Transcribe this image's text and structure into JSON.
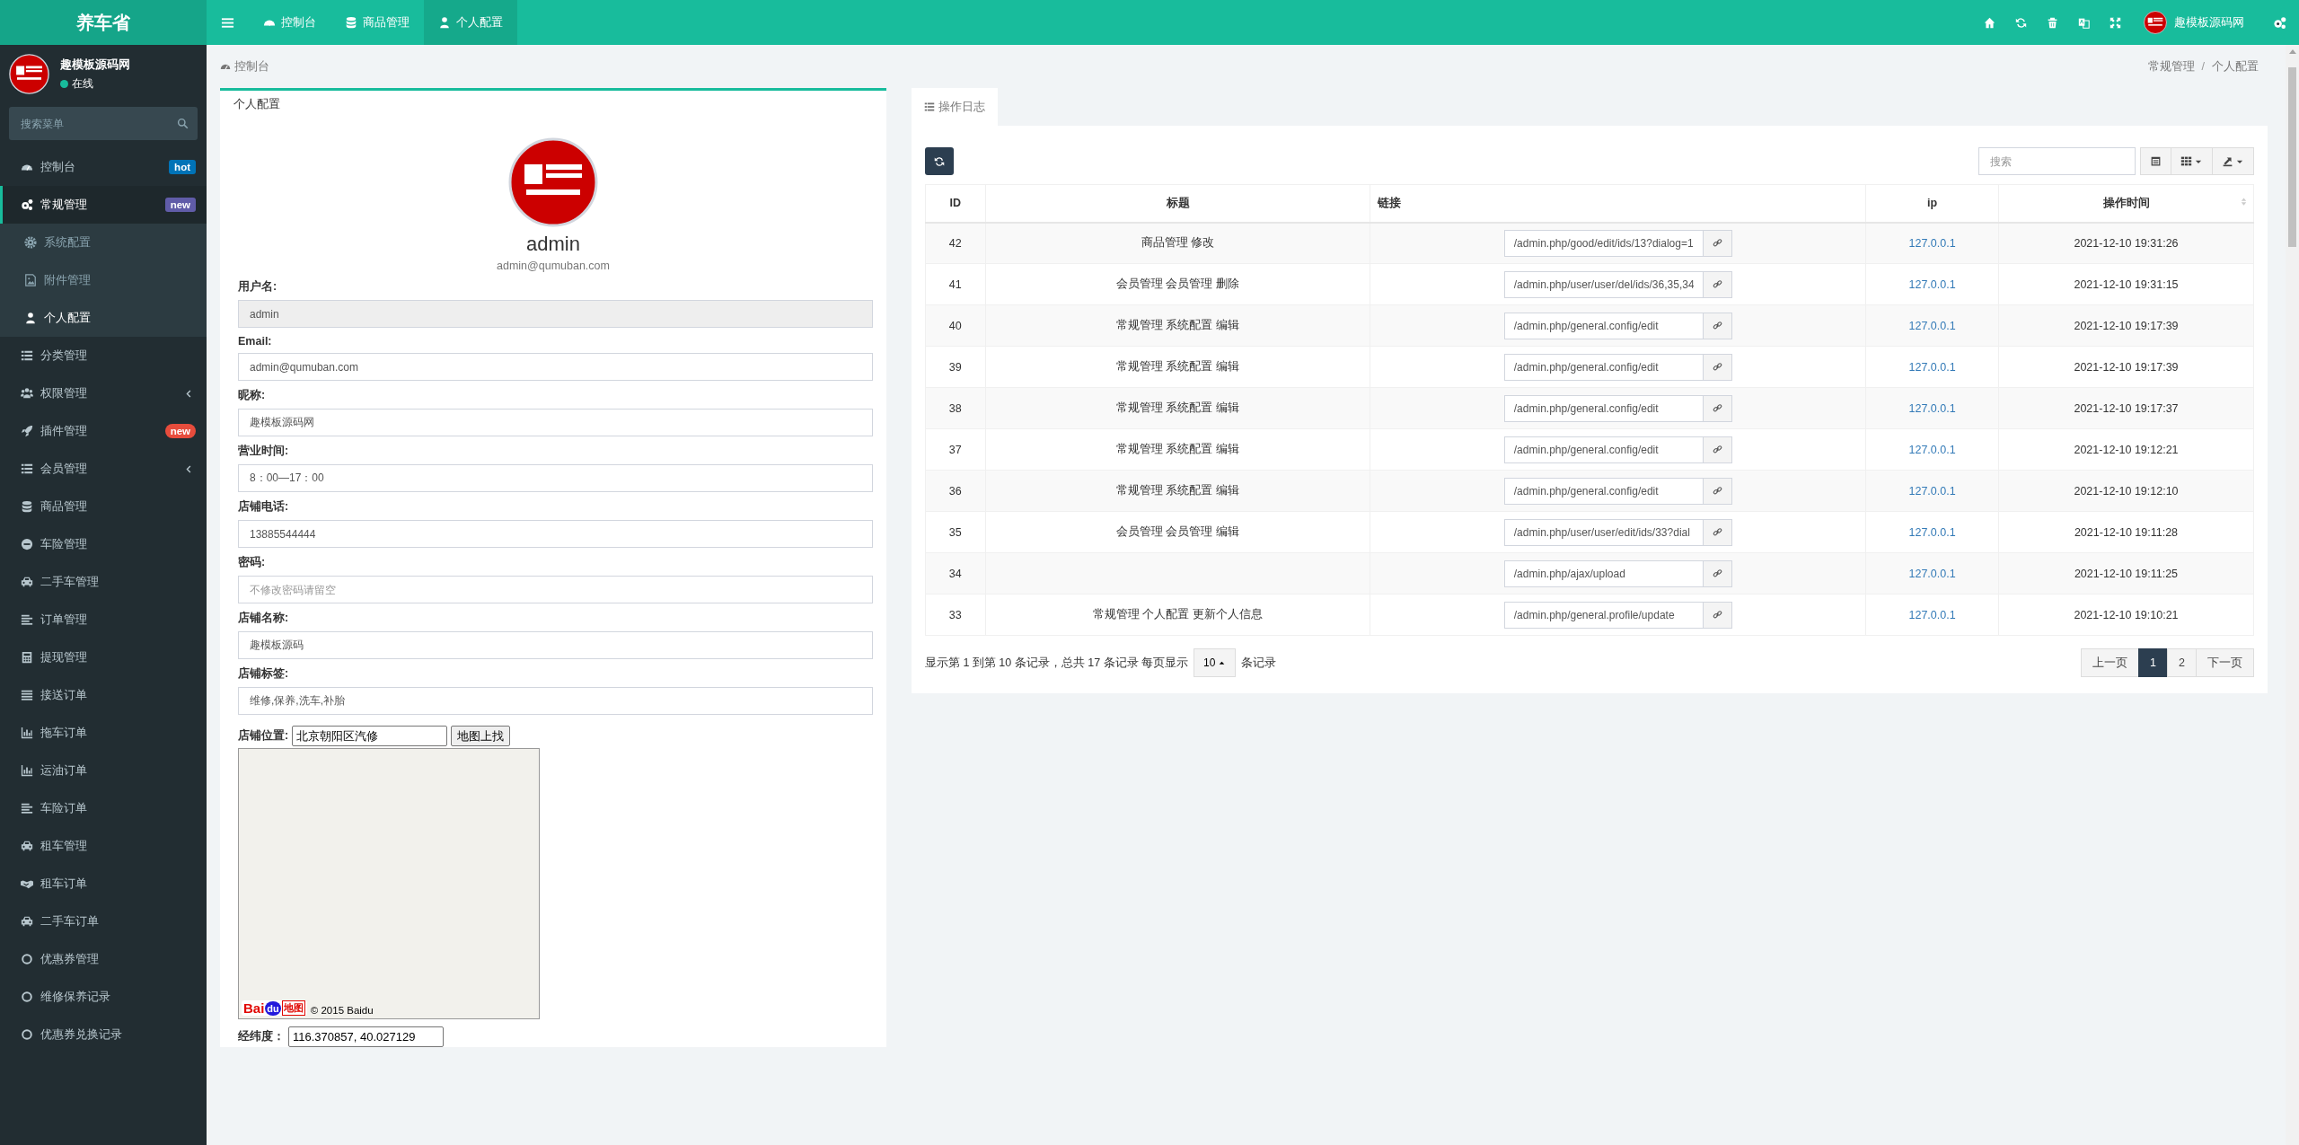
{
  "brand": "养车省",
  "topnav": [
    {
      "kind": "gauge",
      "label": "控制台",
      "selected": false
    },
    {
      "kind": "database",
      "label": "商品管理",
      "selected": false
    },
    {
      "kind": "user",
      "label": "个人配置",
      "selected": true
    }
  ],
  "topbar": {
    "user": "趣模板源码网"
  },
  "sidebar": {
    "user": {
      "name": "趣模板源码网",
      "status": "在线"
    },
    "search": {
      "placeholder": "搜索菜单"
    },
    "items": [
      {
        "kind": "gauge",
        "label": "控制台",
        "selected": false,
        "badge": {
          "text": "hot",
          "color": "#0073b7"
        }
      },
      {
        "kind": "gears",
        "label": "常规管理",
        "selected": true,
        "badge": {
          "text": "new",
          "color": "#605ca8"
        },
        "children": [
          {
            "kind": "gear",
            "label": "系统配置",
            "selected": false
          },
          {
            "kind": "image",
            "label": "附件管理",
            "selected": false
          },
          {
            "kind": "user",
            "label": "个人配置",
            "selected": true
          }
        ]
      },
      {
        "kind": "list",
        "label": "分类管理",
        "selected": false
      },
      {
        "kind": "users",
        "label": "权限管理",
        "selected": false,
        "submenu": true
      },
      {
        "kind": "rocket",
        "label": "插件管理",
        "selected": false,
        "badge": {
          "text": "new",
          "color": "#e74c3c"
        }
      },
      {
        "kind": "list",
        "label": "会员管理",
        "selected": false,
        "submenu": true
      },
      {
        "kind": "database",
        "label": "商品管理",
        "selected": false
      },
      {
        "kind": "minus",
        "label": "车险管理",
        "selected": false
      },
      {
        "kind": "car",
        "label": "二手车管理",
        "selected": false
      },
      {
        "kind": "align",
        "label": "订单管理",
        "selected": false
      },
      {
        "kind": "calculator",
        "label": "提现管理",
        "selected": false
      },
      {
        "kind": "bars",
        "label": "接送订单",
        "selected": false
      },
      {
        "kind": "chart",
        "label": "拖车订单",
        "selected": false
      },
      {
        "kind": "chart",
        "label": "运油订单",
        "selected": false
      },
      {
        "kind": "align",
        "label": "车险订单",
        "selected": false
      },
      {
        "kind": "car",
        "label": "租车管理",
        "selected": false
      },
      {
        "kind": "handshake",
        "label": "租车订单",
        "selected": false
      },
      {
        "kind": "car",
        "label": "二手车订单",
        "selected": false
      },
      {
        "kind": "ring",
        "label": "优惠券管理",
        "selected": false
      },
      {
        "kind": "ring",
        "label": "维修保养记录",
        "selected": false
      },
      {
        "kind": "ring",
        "label": "优惠券兑换记录",
        "selected": false
      }
    ]
  },
  "breadcrumb": {
    "home": "控制台",
    "path": [
      "常规管理",
      "个人配置"
    ],
    "separator": "/"
  },
  "profile": {
    "title": "个人配置",
    "name": "admin",
    "email": "admin@qumuban.com",
    "fields": [
      {
        "label": "用户名:",
        "value": "admin",
        "disabled": true
      },
      {
        "label": "Email:",
        "value": "admin@qumuban.com",
        "disabled": false
      },
      {
        "label": "昵称:",
        "value": "趣模板源码网",
        "disabled": false
      },
      {
        "label": "营业时间:",
        "value": "8：00—17：00",
        "disabled": false
      },
      {
        "label": "店铺电话:",
        "value": "13885544444",
        "disabled": false
      },
      {
        "label": "密码:",
        "placeholder": "不修改密码请留空",
        "disabled": false
      },
      {
        "label": "店铺名称:",
        "value": "趣模板源码",
        "disabled": false
      },
      {
        "label": "店铺标签:",
        "value": "维修,保养,洗车,补胎",
        "disabled": false
      }
    ],
    "location": {
      "label": "店铺位置:",
      "value": "北京朝阳区汽修",
      "button": "地图上找"
    },
    "map": {
      "logo": [
        "Bai",
        "du",
        "地图"
      ],
      "copyright": "© 2015 Baidu"
    },
    "coordinates": {
      "label": "经纬度：",
      "value": "116.370857, 40.027129"
    }
  },
  "log": {
    "tab": "操作日志",
    "search": {
      "placeholder": "搜索"
    },
    "columns": [
      "ID",
      "标题",
      "链接",
      "ip",
      "操作时间"
    ],
    "rows": [
      {
        "id": "42",
        "title": "商品管理 修改",
        "link": "/admin.php/good/edit/ids/13?dialog=1",
        "ip": "127.0.0.1",
        "time": "2021-12-10 19:31:26"
      },
      {
        "id": "41",
        "title": "会员管理 会员管理 删除",
        "link": "/admin.php/user/user/del/ids/36,35,34",
        "ip": "127.0.0.1",
        "time": "2021-12-10 19:31:15"
      },
      {
        "id": "40",
        "title": "常规管理 系统配置 编辑",
        "link": "/admin.php/general.config/edit",
        "ip": "127.0.0.1",
        "time": "2021-12-10 19:17:39"
      },
      {
        "id": "39",
        "title": "常规管理 系统配置 编辑",
        "link": "/admin.php/general.config/edit",
        "ip": "127.0.0.1",
        "time": "2021-12-10 19:17:39"
      },
      {
        "id": "38",
        "title": "常规管理 系统配置 编辑",
        "link": "/admin.php/general.config/edit",
        "ip": "127.0.0.1",
        "time": "2021-12-10 19:17:37"
      },
      {
        "id": "37",
        "title": "常规管理 系统配置 编辑",
        "link": "/admin.php/general.config/edit",
        "ip": "127.0.0.1",
        "time": "2021-12-10 19:12:21"
      },
      {
        "id": "36",
        "title": "常规管理 系统配置 编辑",
        "link": "/admin.php/general.config/edit",
        "ip": "127.0.0.1",
        "time": "2021-12-10 19:12:10"
      },
      {
        "id": "35",
        "title": "会员管理 会员管理 编辑",
        "link": "/admin.php/user/user/edit/ids/33?dial",
        "ip": "127.0.0.1",
        "time": "2021-12-10 19:11:28"
      },
      {
        "id": "34",
        "title": "",
        "link": "/admin.php/ajax/upload",
        "ip": "127.0.0.1",
        "time": "2021-12-10 19:11:25"
      },
      {
        "id": "33",
        "title": "常规管理 个人配置 更新个人信息",
        "link": "/admin.php/general.profile/update",
        "ip": "127.0.0.1",
        "time": "2021-12-10 19:10:21"
      }
    ],
    "summary": "显示第 1 到第 10 条记录，总共 17 条记录 每页显示",
    "page_size": "10",
    "summary_end": "条记录",
    "pages": [
      {
        "label": "上一页",
        "selected": false
      },
      {
        "label": "1",
        "selected": true
      },
      {
        "label": "2",
        "selected": false
      },
      {
        "label": "下一页",
        "selected": false
      }
    ]
  }
}
